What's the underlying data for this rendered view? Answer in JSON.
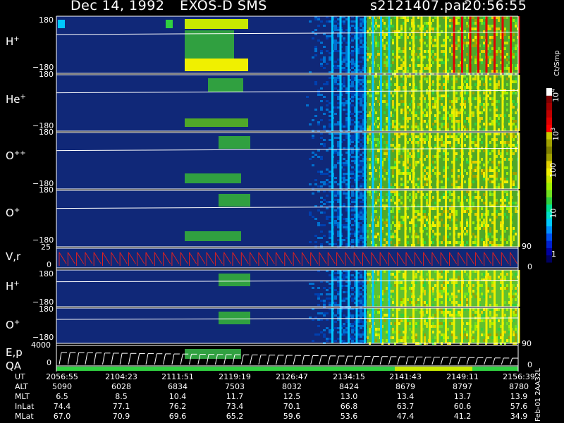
{
  "header": {
    "date": "Dec 14, 1992",
    "instrument": "EXOS-D SMS",
    "file": "s2121407.par",
    "time": "20:56:55"
  },
  "colorbar": {
    "unit": "Ct/Smp",
    "labels": [
      "1",
      "10",
      "100",
      "10",
      "3",
      "10",
      "4"
    ],
    "colors": [
      "#000060",
      "#0000a0",
      "#0020d0",
      "#0050f0",
      "#0090ff",
      "#00c8ff",
      "#00e0c8",
      "#00e090",
      "#30d040",
      "#70e020",
      "#a0f000",
      "#c8e800",
      "#f0f000",
      "#e0d000",
      "#a0a000",
      "#808000",
      "#a0a000",
      "#c8c800",
      "#ff0000",
      "#e00000",
      "#c00000",
      "#a00000",
      "#800000",
      "#ffffff"
    ]
  },
  "panels": [
    {
      "label": "H",
      "sup": "+",
      "ytop": "180",
      "ybot": "−180"
    },
    {
      "label": "He",
      "sup": "+",
      "ytop": "180",
      "ybot": "−180"
    },
    {
      "label": "O",
      "sup": "++",
      "ytop": "180",
      "ybot": "−180"
    },
    {
      "label": "O",
      "sup": "+",
      "ytop": "180",
      "ybot": "−180"
    },
    {
      "label": "V,r",
      "sup": "",
      "ytop": "25",
      "ybot": "0",
      "rtop": "90",
      "rbot": "0"
    },
    {
      "label": "H",
      "sup": "+",
      "ytop": "180",
      "ybot": "−180"
    },
    {
      "label": "O",
      "sup": "+",
      "ytop": "180",
      "ybot": "−180",
      "rbot": "90"
    },
    {
      "label": "E,p",
      "sup": "",
      "ytop": "4000",
      "ybot": "0",
      "rbot": "0"
    },
    {
      "label": "QA",
      "sup": "",
      "ytop": "",
      "ybot": ""
    }
  ],
  "ephemeris": {
    "rows": [
      {
        "name": "UT",
        "values": [
          "2056:55",
          "2104:23",
          "2111:51",
          "2119:19",
          "2126:47",
          "2134:15",
          "2141:43",
          "2149:11",
          "2156:39"
        ]
      },
      {
        "name": "ALT",
        "values": [
          "5090",
          "6028",
          "6834",
          "7503",
          "8032",
          "8424",
          "8679",
          "8797",
          "8780"
        ]
      },
      {
        "name": "MLT",
        "values": [
          "6.5",
          "8.5",
          "10.4",
          "11.7",
          "12.5",
          "13.0",
          "13.4",
          "13.7",
          "13.9"
        ]
      },
      {
        "name": "InLat",
        "values": [
          "74.4",
          "77.1",
          "76.2",
          "73.4",
          "70.1",
          "66.8",
          "63.7",
          "60.6",
          "57.6"
        ]
      },
      {
        "name": "MLat",
        "values": [
          "67.0",
          "70.9",
          "69.6",
          "65.2",
          "59.6",
          "53.6",
          "47.4",
          "41.2",
          "34.9"
        ]
      }
    ]
  },
  "side_note": "Feb-01 2AA32L"
}
